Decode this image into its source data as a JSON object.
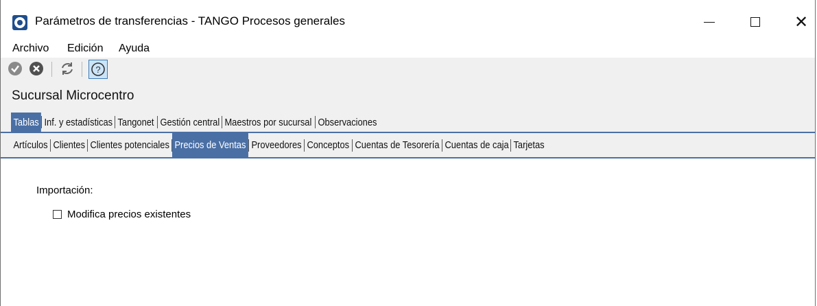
{
  "window": {
    "title": "Parámetros de transferencias - TANGO Procesos generales",
    "minimize": "—",
    "close": "✕"
  },
  "menu": [
    "Archivo",
    "Edición",
    "Ayuda"
  ],
  "toolbar": {
    "icons": [
      "check-circle-icon",
      "cancel-circle-icon",
      "refresh-icon",
      "help-icon"
    ],
    "help_label": "?"
  },
  "branch_title": "Sucursal Microcentro",
  "main_tabs": {
    "items": [
      "Tablas",
      "Inf. y estadísticas",
      "Tangonet",
      "Gestión central",
      "Maestros por sucursal",
      "Observaciones"
    ],
    "active": "Tablas"
  },
  "sub_tabs": {
    "items": [
      "Artículos",
      "Clientes",
      "Clientes potenciales",
      "Precios de Ventas",
      "Proveedores",
      "Conceptos",
      "Cuentas de Tesorería",
      "Cuentas de caja",
      "Tarjetas"
    ],
    "active": "Precios de Ventas"
  },
  "content": {
    "section_label": "Importación:",
    "checkbox_label": "Modifica precios existentes",
    "checkbox_checked": false
  },
  "colors": {
    "accent": "#4a6fa5",
    "toolbar_bg": "#f0f0f0"
  }
}
